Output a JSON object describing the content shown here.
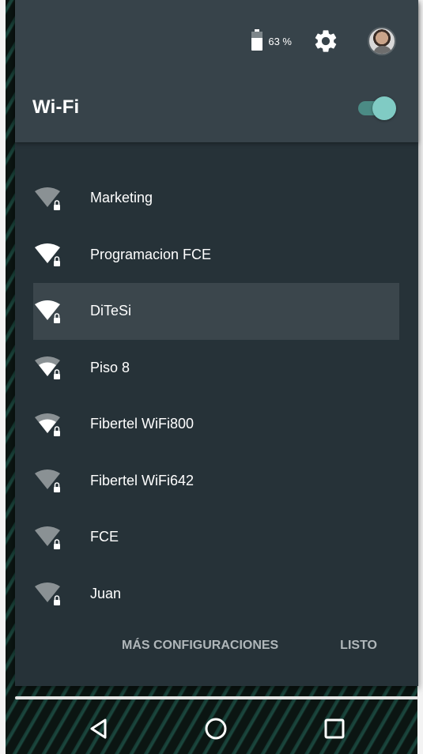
{
  "status": {
    "battery_text": "63 %",
    "battery_level": 0.63
  },
  "wifi": {
    "title": "Wi-Fi",
    "enabled": true
  },
  "networks": [
    {
      "name": "Marketing",
      "signal": 1,
      "locked": true,
      "selected": false
    },
    {
      "name": "Programacion FCE",
      "signal": 3,
      "locked": true,
      "selected": false
    },
    {
      "name": "DiTeSi",
      "signal": 3,
      "locked": true,
      "selected": true
    },
    {
      "name": "Piso 8",
      "signal": 2,
      "locked": true,
      "selected": false
    },
    {
      "name": "Fibertel WiFi800",
      "signal": 2,
      "locked": true,
      "selected": false
    },
    {
      "name": "Fibertel WiFi642",
      "signal": 1,
      "locked": true,
      "selected": false
    },
    {
      "name": "FCE",
      "signal": 1,
      "locked": true,
      "selected": false
    },
    {
      "name": "Juan",
      "signal": 1,
      "locked": true,
      "selected": false
    }
  ],
  "footer": {
    "more_label": "MÁS CONFIGURACIONES",
    "done_label": "LISTO"
  },
  "colors": {
    "panel": "#263238",
    "header": "#37434a",
    "accent": "#80cbc4",
    "selected_row": "#3b464c",
    "signal_on": "#ffffff",
    "signal_off": "#8a9194"
  },
  "icons": {
    "settings": "gear-icon",
    "user": "avatar",
    "nav_back": "back-triangle-icon",
    "nav_home": "home-circle-icon",
    "nav_recent": "recents-square-icon"
  }
}
